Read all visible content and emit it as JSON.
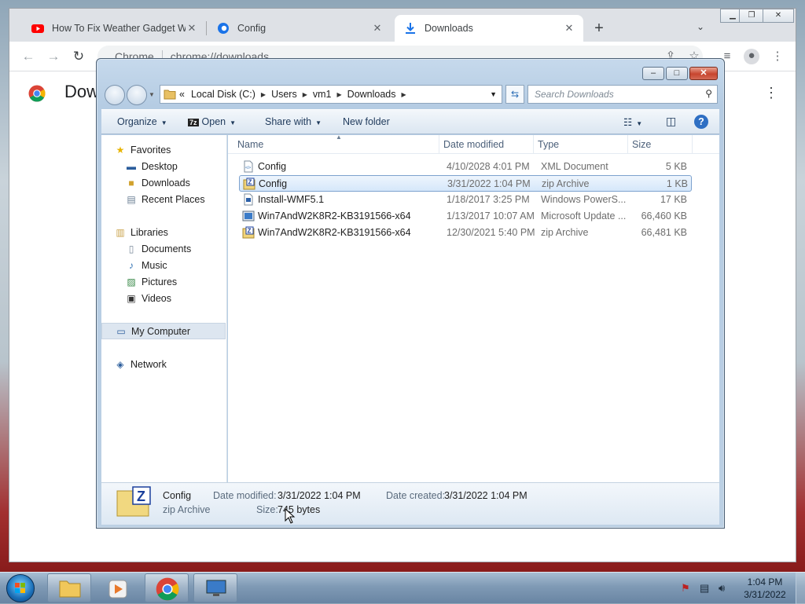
{
  "browser": {
    "tabs": [
      {
        "title": "How To Fix Weather Gadget WIN",
        "close": "✕"
      },
      {
        "title": "Config",
        "close": "✕"
      },
      {
        "title": "Downloads",
        "close": "✕"
      }
    ],
    "new_tab": "+",
    "tab_search": "⌄",
    "omnibox": {
      "site_label": "Chrome",
      "url": "chrome://downloads"
    },
    "page_title": "Dow",
    "colors": {
      "youtube": "#ff0000",
      "accent": "#1a73e8"
    }
  },
  "explorer": {
    "caption_buttons": {
      "minimize": "–",
      "maximize": "□",
      "close": "✕"
    },
    "breadcrumb": [
      "«",
      "Local Disk (C:)",
      "Users",
      "vm1",
      "Downloads"
    ],
    "search_placeholder": "Search Downloads",
    "commands": {
      "organize": "Organize",
      "open": "Open",
      "share_with": "Share with",
      "new_folder": "New folder"
    },
    "nav": {
      "favorites": "Favorites",
      "desktop": "Desktop",
      "downloads": "Downloads",
      "recent_places": "Recent Places",
      "libraries": "Libraries",
      "documents": "Documents",
      "music": "Music",
      "pictures": "Pictures",
      "videos": "Videos",
      "my_computer": "My Computer",
      "network": "Network"
    },
    "columns": {
      "name": "Name",
      "date": "Date modified",
      "type": "Type",
      "size": "Size"
    },
    "files": [
      {
        "name": "Config",
        "date": "4/10/2028 4:01 PM",
        "type": "XML Document",
        "size": "5 KB",
        "icon": "xml-icon"
      },
      {
        "name": "Config",
        "date": "3/31/2022 1:04 PM",
        "type": "zip Archive",
        "size": "1 KB",
        "icon": "zip-icon"
      },
      {
        "name": "Install-WMF5.1",
        "date": "1/18/2017 3:25 PM",
        "type": "Windows PowerS...",
        "size": "17 KB",
        "icon": "powershell-icon"
      },
      {
        "name": "Win7AndW2K8R2-KB3191566-x64",
        "date": "1/13/2017 10:07 AM",
        "type": "Microsoft Update ...",
        "size": "66,460 KB",
        "icon": "msu-icon"
      },
      {
        "name": "Win7AndW2K8R2-KB3191566-x64",
        "date": "12/30/2021 5:40 PM",
        "type": "zip Archive",
        "size": "66,481 KB",
        "icon": "zip-icon"
      }
    ],
    "selected_index": 1,
    "details": {
      "name": "Config",
      "type": "zip Archive",
      "date_modified_label": "Date modified:",
      "date_modified": "3/31/2022 1:04 PM",
      "date_created_label": "Date created:",
      "date_created": "3/31/2022 1:04 PM",
      "size_label": "Size:",
      "size": "745 bytes"
    }
  },
  "taskbar": {
    "clock_time": "1:04 PM",
    "clock_date": "3/31/2022"
  }
}
